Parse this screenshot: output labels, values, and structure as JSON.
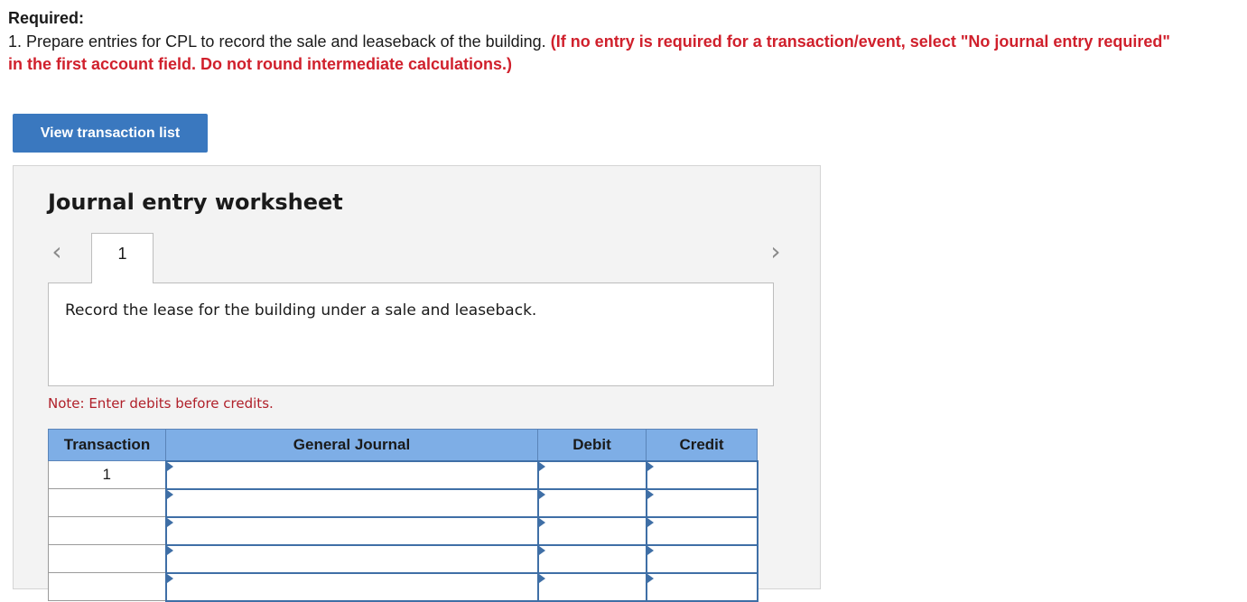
{
  "header": {
    "required_label": "Required:",
    "instruction_main": "1. Prepare entries for CPL to record the sale and leaseback of the building. ",
    "instruction_warning": "(If no entry is required for a transaction/event, select \"No journal entry required\" in the first account field. Do not round intermediate calculations.)"
  },
  "buttons": {
    "view_transaction_list": "View transaction list"
  },
  "worksheet": {
    "title": "Journal entry worksheet",
    "nav_prev": "‹",
    "nav_next": "›",
    "active_tab": "1",
    "description": "Record the lease for the building under a sale and leaseback.",
    "note": "Note: Enter debits before credits."
  },
  "journal_table": {
    "columns": [
      "Transaction",
      "General Journal",
      "Debit",
      "Credit"
    ],
    "rows": [
      {
        "transaction": "1",
        "general_journal": "",
        "debit": "",
        "credit": ""
      },
      {
        "transaction": "",
        "general_journal": "",
        "debit": "",
        "credit": ""
      },
      {
        "transaction": "",
        "general_journal": "",
        "debit": "",
        "credit": ""
      },
      {
        "transaction": "",
        "general_journal": "",
        "debit": "",
        "credit": ""
      },
      {
        "transaction": "",
        "general_journal": "",
        "debit": "",
        "credit": ""
      }
    ]
  },
  "colors": {
    "accent_button": "#3a78bf",
    "warning_text": "#d0202c",
    "table_header": "#7eaee6",
    "entry_border": "#3f6fa6"
  }
}
